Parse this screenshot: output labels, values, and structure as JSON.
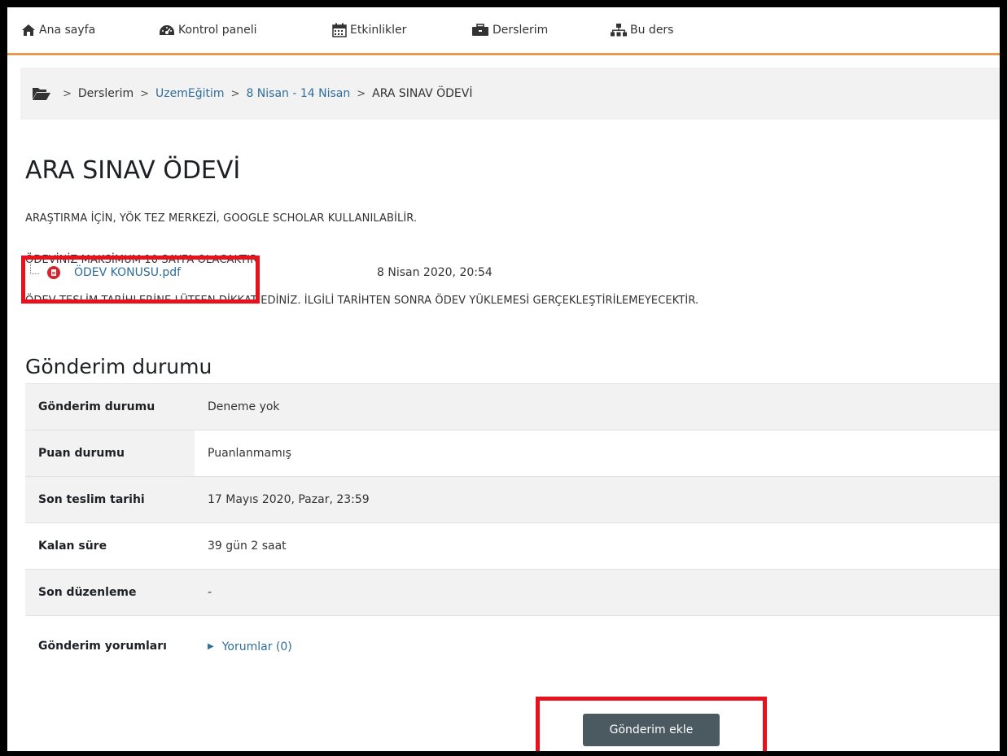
{
  "nav": {
    "items": [
      {
        "label": "Ana sayfa",
        "icon": "home-icon"
      },
      {
        "label": "Kontrol paneli",
        "icon": "dashboard-icon"
      },
      {
        "label": "Etkinlikler",
        "icon": "calendar-icon"
      },
      {
        "label": "Derslerim",
        "icon": "briefcase-icon"
      },
      {
        "label": "Bu ders",
        "icon": "sitemap-icon"
      }
    ],
    "accent_color": "#e89a4f"
  },
  "breadcrumb": {
    "icon": "folder-open-icon",
    "separator": ">",
    "items": [
      {
        "label": "Derslerim",
        "link": false
      },
      {
        "label": "UzemEğitim",
        "link": true
      },
      {
        "label": "8 Nisan - 14 Nisan",
        "link": true
      },
      {
        "label": "ARA SINAV ÖDEVİ",
        "link": false
      }
    ]
  },
  "page": {
    "title": "ARA SINAV ÖDEVİ",
    "description": [
      "ARAŞTIRMA İÇİN, YÖK TEZ MERKEZİ, GOOGLE SCHOLAR KULLANILABİLİR.",
      "ÖDEVİNİZ MAKSİMUM 10 SAYFA OLACAKTIR.",
      "ÖDEV TESLİM TARİHLERİNE LÜTFEN DİKKAT EDİNİZ. İLGİLİ TARİHTEN SONRA ÖDEV YÜKLEMESİ GERÇEKLEŞTİRİLEMEYECEKTİR."
    ],
    "attachment": {
      "name": "ÖDEV KONUSU.pdf",
      "date": "8 Nisan 2020, 20:54",
      "icon": "pdf-icon"
    }
  },
  "status": {
    "heading": "Gönderim durumu",
    "rows": [
      {
        "label": "Gönderim durumu",
        "value": "Deneme yok"
      },
      {
        "label": "Puan durumu",
        "value": "Puanlanmamış"
      },
      {
        "label": "Son teslim tarihi",
        "value": "17 Mayıs 2020, Pazar, 23:59"
      },
      {
        "label": "Kalan süre",
        "value": "39 gün 2 saat"
      },
      {
        "label": "Son düzenleme",
        "value": "-"
      },
      {
        "label": "Gönderim yorumları",
        "value": "Yorumlar (0)"
      }
    ]
  },
  "actions": {
    "add_submission": "Gönderim ekle"
  },
  "annotations": {
    "highlight_color": "#e8121e"
  }
}
